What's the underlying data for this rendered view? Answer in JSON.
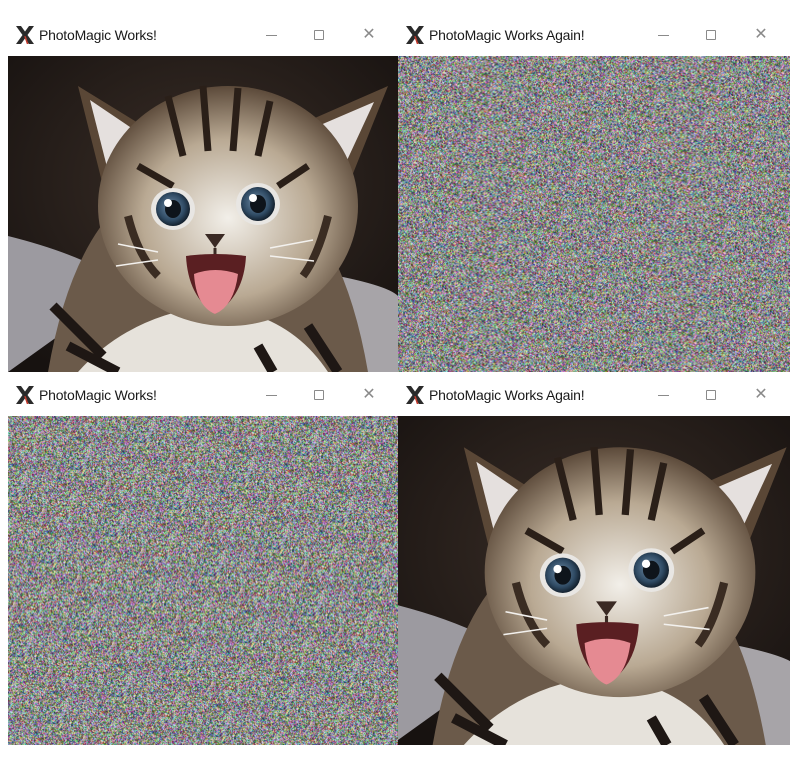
{
  "windows": [
    {
      "title": "PhotoMagic Works!",
      "content": "kitten-photo"
    },
    {
      "title": "PhotoMagic Works Again!",
      "content": "noise"
    },
    {
      "title": "PhotoMagic Works!",
      "content": "noise"
    },
    {
      "title": "PhotoMagic Works Again!",
      "content": "kitten-photo"
    }
  ],
  "controls": {
    "minimize": "—",
    "maximize": "☐",
    "close": "✕"
  },
  "icons": {
    "app": "x-window-system-icon"
  }
}
